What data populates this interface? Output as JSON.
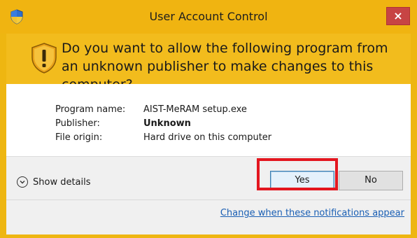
{
  "window": {
    "title": "User Account Control",
    "close_symbol": "×",
    "accent_color": "#f0b411"
  },
  "header": {
    "question": "Do you want to allow the following program from an unknown publisher to make changes to this computer?"
  },
  "details": [
    {
      "label": "Program name:",
      "value": "AIST-MeRAM setup.exe",
      "bold": false
    },
    {
      "label": "Publisher:",
      "value": "Unknown",
      "bold": true
    },
    {
      "label": "File origin:",
      "value": "Hard drive on this computer",
      "bold": false
    }
  ],
  "footer": {
    "show_details_label": "Show details",
    "yes_label": "Yes",
    "no_label": "No",
    "notifications_link": "Change when these notifications appear"
  },
  "annotation": {
    "highlight_color": "#e3161f",
    "highlight_target": "yes-button"
  },
  "icons": {
    "title_icon": "uac-shield-icon",
    "warning_icon": "warning-shield-icon",
    "expand_icon": "chevron-down-icon"
  }
}
